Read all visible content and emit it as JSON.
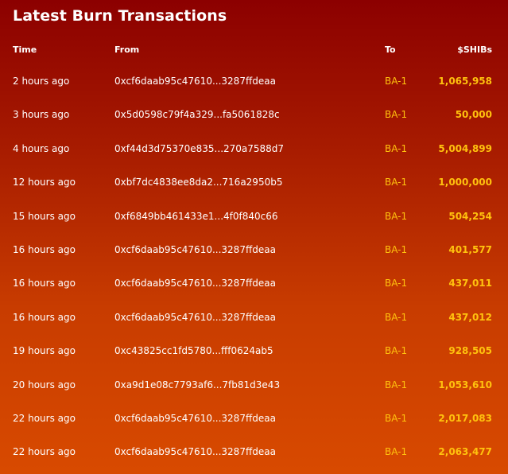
{
  "title": "Latest Burn Transactions",
  "columns": {
    "time": "Time",
    "from": "From",
    "to": "To",
    "amount": "$SHIBs"
  },
  "colors": {
    "accent": "#ffc20e",
    "background_top": "#8c0000",
    "background_bottom": "#d84a00",
    "text": "#ffffff"
  },
  "rows": [
    {
      "time": "2 hours ago",
      "from": "0xcf6daab95c47610...3287ffdeaa",
      "to": "BA-1",
      "amount": "1,065,958"
    },
    {
      "time": "3 hours ago",
      "from": "0x5d0598c79f4a329...fa5061828c",
      "to": "BA-1",
      "amount": "50,000"
    },
    {
      "time": "4 hours ago",
      "from": "0xf44d3d75370e835...270a7588d7",
      "to": "BA-1",
      "amount": "5,004,899"
    },
    {
      "time": "12 hours ago",
      "from": "0xbf7dc4838ee8da2...716a2950b5",
      "to": "BA-1",
      "amount": "1,000,000"
    },
    {
      "time": "15 hours ago",
      "from": "0xf6849bb461433e1...4f0f840c66",
      "to": "BA-1",
      "amount": "504,254"
    },
    {
      "time": "16 hours ago",
      "from": "0xcf6daab95c47610...3287ffdeaa",
      "to": "BA-1",
      "amount": "401,577"
    },
    {
      "time": "16 hours ago",
      "from": "0xcf6daab95c47610...3287ffdeaa",
      "to": "BA-1",
      "amount": "437,011"
    },
    {
      "time": "16 hours ago",
      "from": "0xcf6daab95c47610...3287ffdeaa",
      "to": "BA-1",
      "amount": "437,012"
    },
    {
      "time": "19 hours ago",
      "from": "0xc43825cc1fd5780...fff0624ab5",
      "to": "BA-1",
      "amount": "928,505"
    },
    {
      "time": "20 hours ago",
      "from": "0xa9d1e08c7793af6...7fb81d3e43",
      "to": "BA-1",
      "amount": "1,053,610"
    },
    {
      "time": "22 hours ago",
      "from": "0xcf6daab95c47610...3287ffdeaa",
      "to": "BA-1",
      "amount": "2,017,083"
    },
    {
      "time": "22 hours ago",
      "from": "0xcf6daab95c47610...3287ffdeaa",
      "to": "BA-1",
      "amount": "2,063,477"
    }
  ]
}
